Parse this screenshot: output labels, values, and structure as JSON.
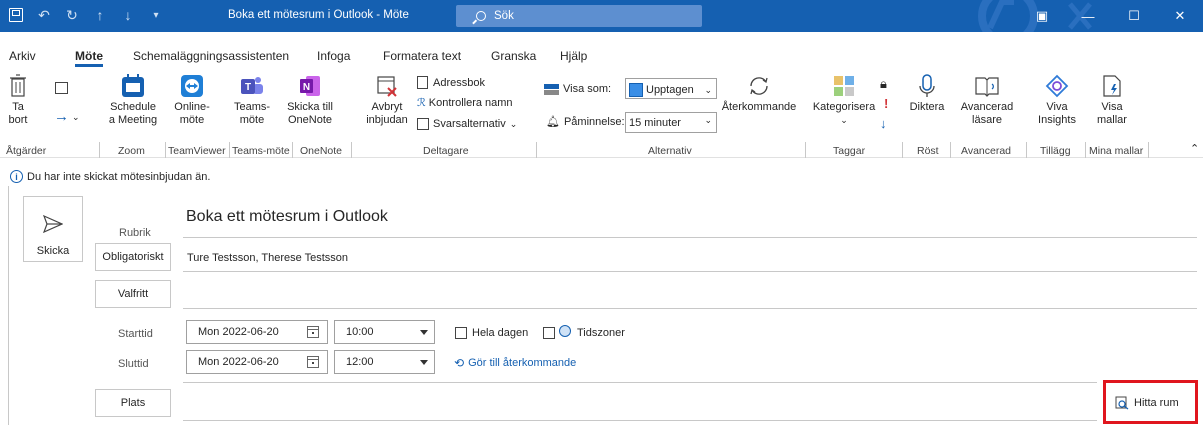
{
  "window": {
    "title": "Boka ett mötesrum i Outlook  -  Möte",
    "search_placeholder": "Sök"
  },
  "menu": {
    "tabs": [
      "Arkiv",
      "Möte",
      "Schemaläggningsassistenten",
      "Infoga",
      "Formatera text",
      "Granska",
      "Hjälp"
    ],
    "active_tab": "Möte"
  },
  "ribbon": {
    "delete": {
      "line1": "Ta",
      "line2": "bort"
    },
    "schedule": {
      "line1": "Schedule",
      "line2": "a Meeting"
    },
    "online_meeting": {
      "line1": "Online-",
      "line2": "möte"
    },
    "teams_meeting": {
      "line1": "Teams-",
      "line2": "möte"
    },
    "onenote": {
      "line1": "Skicka till",
      "line2": "OneNote"
    },
    "cancel_invite": {
      "line1": "Avbryt",
      "line2": "inbjudan"
    },
    "address_book": "Adressbok",
    "check_names": "Kontrollera namn",
    "response_options": "Svarsalternativ",
    "show_as_label": "Visa som:",
    "show_as_value": "Upptagen",
    "reminder_label": "Påminnelse:",
    "reminder_value": "15 minuter",
    "recurring": "Återkommande",
    "categorize": "Kategorisera",
    "dictate": "Diktera",
    "immersive_reader": {
      "line1": "Avancerad",
      "line2": "läsare"
    },
    "viva_insights": {
      "line1": "Viva",
      "line2": "Insights"
    },
    "view_templates": {
      "line1": "Visa",
      "line2": "mallar"
    },
    "groups": [
      "Åtgärder",
      "Zoom",
      "TeamViewer",
      "Teams-möte",
      "OneNote",
      "Deltagare",
      "Alternativ",
      "Taggar",
      "Röst",
      "Avancerad",
      "Tillägg",
      "Mina mallar"
    ]
  },
  "form": {
    "info": "Du har inte skickat mötesinbjudan än.",
    "send": "Skicka",
    "subject_label": "Rubrik",
    "subject": "Boka ett mötesrum i Outlook",
    "required_button": "Obligatoriskt",
    "required_value": "Ture Testsson, Therese Testsson",
    "optional_button": "Valfritt",
    "start_label": "Starttid",
    "start_date": "Mon 2022-06-20",
    "start_time": "10:00",
    "end_label": "Sluttid",
    "end_date": "Mon 2022-06-20",
    "end_time": "12:00",
    "all_day": "Hela dagen",
    "time_zones": "Tidszoner",
    "make_recurring": "Gör till återkommande",
    "location_button": "Plats",
    "room_finder": "Hitta rum"
  },
  "colors": {
    "titlebar": "#1560b1",
    "accent": "#1560b1",
    "highlight": "#e0161e"
  }
}
